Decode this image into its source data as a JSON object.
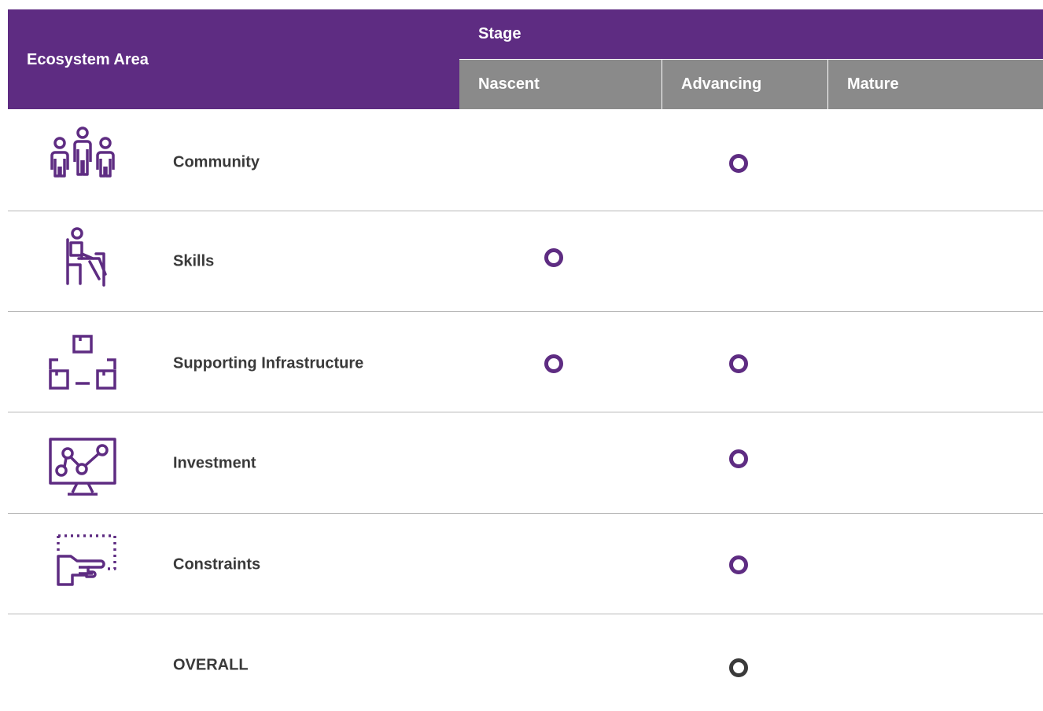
{
  "header": {
    "area_label": "Ecosystem Area",
    "stage_label": "Stage",
    "stages": [
      "Nascent",
      "Advancing",
      "Mature"
    ]
  },
  "colors": {
    "primary": "#5e2c82",
    "subheader": "#8a8a8a",
    "text": "#3a3a3a",
    "divider": "#b8b8b8"
  },
  "rows": [
    {
      "label": "Community",
      "icon": "community-icon",
      "stages_marked": [
        "Advancing"
      ]
    },
    {
      "label": "Skills",
      "icon": "skills-icon",
      "stages_marked": [
        "Nascent"
      ]
    },
    {
      "label": "Supporting Infrastructure",
      "icon": "infrastructure-icon",
      "stages_marked": [
        "Nascent",
        "Advancing"
      ]
    },
    {
      "label": "Investment",
      "icon": "investment-icon",
      "stages_marked": [
        "Advancing"
      ]
    },
    {
      "label": "Constraints",
      "icon": "constraints-icon",
      "stages_marked": [
        "Advancing"
      ]
    },
    {
      "label": "OVERALL",
      "icon": "",
      "stages_marked": [
        "Advancing"
      ]
    }
  ]
}
